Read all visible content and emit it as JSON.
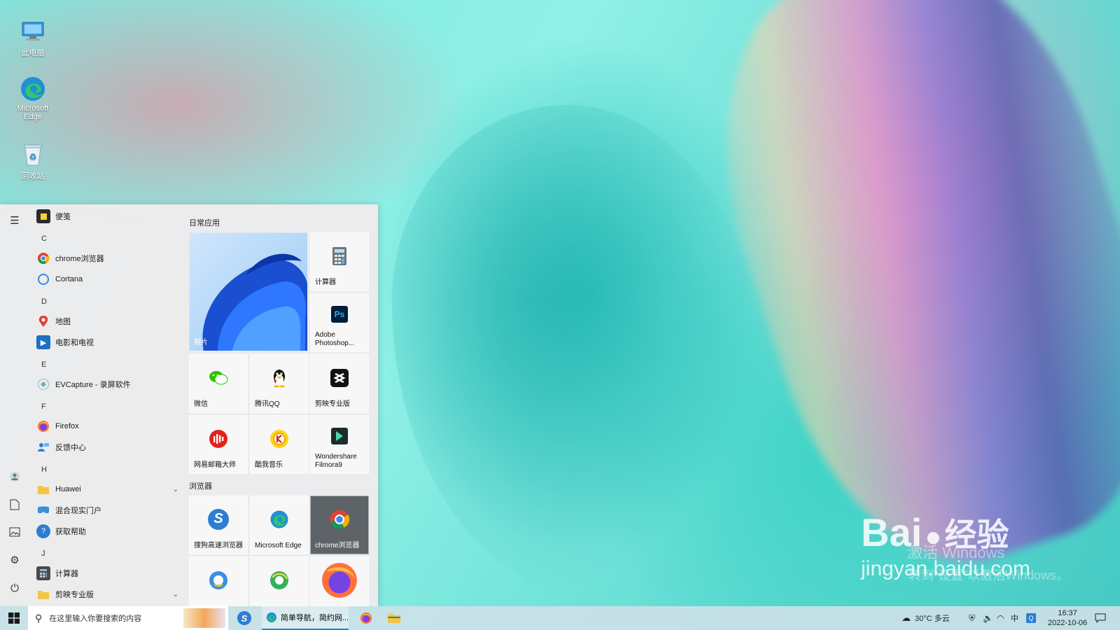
{
  "desktop": {
    "icons": [
      {
        "label": "此电脑",
        "icon": "computer-icon"
      },
      {
        "label": "Microsoft Edge",
        "icon": "edge-icon"
      },
      {
        "label": "回收站",
        "icon": "recycle-bin-icon"
      }
    ]
  },
  "start_menu": {
    "apps": [
      {
        "label": "便笺",
        "icon": "sticky-notes-icon",
        "color": "#2b2b2b"
      },
      {
        "letter": "C"
      },
      {
        "label": "chrome浏览器",
        "icon": "chrome-icon"
      },
      {
        "label": "Cortana",
        "icon": "cortana-icon"
      },
      {
        "letter": "D"
      },
      {
        "label": "地图",
        "icon": "maps-icon",
        "color": "#e0403a"
      },
      {
        "label": "电影和电视",
        "icon": "movies-tv-icon",
        "color": "#1f6fc4"
      },
      {
        "letter": "E"
      },
      {
        "label": "EVCapture - 录屏软件",
        "icon": "evcapture-icon"
      },
      {
        "letter": "F"
      },
      {
        "label": "Firefox",
        "icon": "firefox-icon"
      },
      {
        "label": "反馈中心",
        "icon": "feedback-hub-icon",
        "color": "#2d7dd2"
      },
      {
        "letter": "H"
      },
      {
        "label": "Huawei",
        "icon": "folder-icon",
        "expandable": true
      },
      {
        "label": "混合现实门户",
        "icon": "mixed-reality-icon",
        "color": "#3a8fd8"
      },
      {
        "label": "获取帮助",
        "icon": "get-help-icon",
        "color": "#2d7dd2"
      },
      {
        "letter": "J"
      },
      {
        "label": "计算器",
        "icon": "calculator-icon",
        "color": "#4a4a4a"
      },
      {
        "label": "剪映专业版",
        "icon": "folder-icon",
        "expandable": true
      }
    ],
    "groups": [
      {
        "title": "日常应用"
      },
      {
        "title": "浏览器"
      }
    ],
    "tiles_daily": [
      {
        "label": "照片",
        "icon": "photos-icon"
      },
      {
        "label": "计算器",
        "icon": "calculator-icon"
      },
      {
        "label": "Adobe Photoshop...",
        "icon": "photoshop-icon",
        "glyph": "Ps"
      },
      {
        "label": "微信",
        "icon": "wechat-icon"
      },
      {
        "label": "腾讯QQ",
        "icon": "qq-icon"
      },
      {
        "label": "剪映专业版",
        "icon": "capcut-icon"
      },
      {
        "label": "网易邮箱大师",
        "icon": "netease-mail-icon"
      },
      {
        "label": "酷我音乐",
        "icon": "kuwo-music-icon"
      },
      {
        "label": "Wondershare Filmora9",
        "icon": "filmora-icon"
      }
    ],
    "tiles_browser": [
      {
        "label": "搜狗高速浏览器",
        "icon": "sogou-browser-icon",
        "glyph": "S"
      },
      {
        "label": "Microsoft Edge",
        "icon": "edge-icon"
      },
      {
        "label": "chrome浏览器",
        "icon": "chrome-icon"
      },
      {
        "label": "",
        "icon": "browser-icon"
      },
      {
        "label": "",
        "icon": "browser-green-icon"
      },
      {
        "label": "",
        "icon": "firefox-icon"
      }
    ]
  },
  "taskbar": {
    "search_placeholder": "在这里输入你要搜索的内容",
    "active_window": "简单导航，简约网...",
    "weather": "30°C 多云",
    "time": "16:37",
    "date": "2022-10-06"
  },
  "watermark": {
    "brand": "Bai",
    "brand_suffix": "经验",
    "url": "jingyan.baidu.com",
    "activation_line1": "激活 Windows",
    "activation_line2": "转到“设置”以激活Windows。"
  }
}
